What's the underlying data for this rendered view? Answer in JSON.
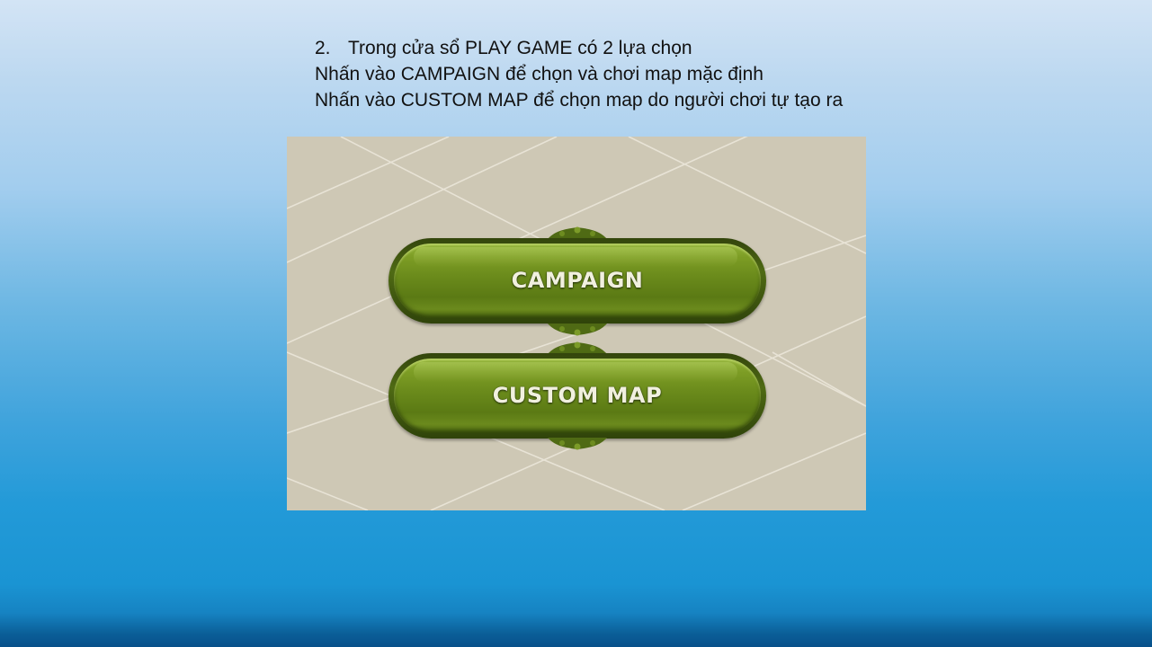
{
  "instructions": {
    "step_number": "2.",
    "line1": "Trong cửa sổ PLAY GAME có 2 lựa chọn",
    "line2": "Nhấn vào CAMPAIGN để chọn và chơi map mặc định",
    "line3": "Nhấn vào CUSTOM MAP để chọn map do người chơi tự tạo ra"
  },
  "game_menu": {
    "campaign_label": "CAMPAIGN",
    "custom_map_label": "CUSTOM MAP"
  },
  "colors": {
    "button_green": "#6a8a1b",
    "button_text": "#f1f0df",
    "panel_background": "#cec8b5",
    "slide_blue": "#1a94d3"
  }
}
